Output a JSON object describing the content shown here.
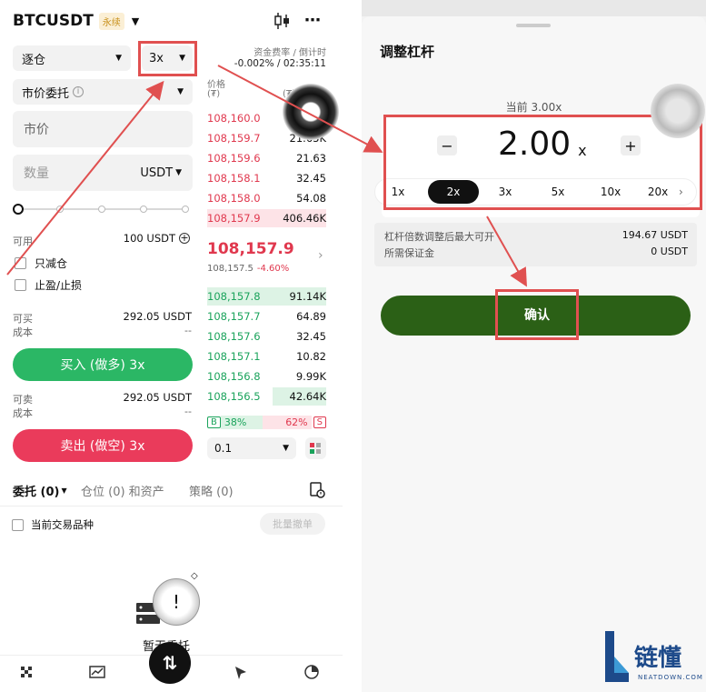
{
  "left": {
    "header": {
      "symbol": "BTCUSDT",
      "badge": "永续"
    },
    "margin_mode": "逐仓",
    "leverage": "3x",
    "funding": {
      "label": "资金费率 / 倒计时",
      "value": "-0.002% / 02:35:11"
    },
    "order_type": "市价委托",
    "price_col": {
      "label": "价格",
      "unit": "(₮)",
      "qty_label": "(₮)"
    },
    "price_input": "市价",
    "qty_input": "数量",
    "qty_unit": "USDT",
    "available_label": "可用",
    "available_value": "100 USDT",
    "reduce_only": "只减仓",
    "tp_sl": "止盈/止损",
    "buy_info": {
      "label1": "可买",
      "value1": "292.05 USDT",
      "label2": "成本",
      "value2": "--"
    },
    "buy_button": "买入 (做多) 3x",
    "sell_info": {
      "label1": "可卖",
      "value1": "292.05 USDT",
      "label2": "成本",
      "value2": "--"
    },
    "sell_button": "卖出 (做空) 3x",
    "asks": [
      {
        "price": "108,160.0",
        "qty": ""
      },
      {
        "price": "108,159.7",
        "qty": "21.63K"
      },
      {
        "price": "108,159.6",
        "qty": "21.63"
      },
      {
        "price": "108,158.1",
        "qty": "32.45"
      },
      {
        "price": "108,158.0",
        "qty": "54.08"
      },
      {
        "price": "108,157.9",
        "qty": "406.46K"
      }
    ],
    "last_price": "108,157.9",
    "mark_price": "108,157.5",
    "change": "-4.60%",
    "bids": [
      {
        "price": "108,157.8",
        "qty": "91.14K"
      },
      {
        "price": "108,157.7",
        "qty": "64.89"
      },
      {
        "price": "108,157.6",
        "qty": "32.45"
      },
      {
        "price": "108,157.1",
        "qty": "10.82"
      },
      {
        "price": "108,156.8",
        "qty": "9.99K"
      },
      {
        "price": "108,156.5",
        "qty": "42.64K"
      }
    ],
    "ratio": {
      "b": "B",
      "b_pct": "38%",
      "s_pct": "62%",
      "s": "S"
    },
    "depth_select": "0.1",
    "tabs": [
      "委托 (0)",
      "仓位 (0) 和资产",
      "策略 (0)"
    ],
    "current_symbol_only": "当前交易品种",
    "batch_cancel": "批量撤单",
    "empty_text": "暂无委托"
  },
  "right": {
    "title": "调整杠杆",
    "current": "当前 3.00x",
    "value": "2.00",
    "unit": "x",
    "minus": "−",
    "plus": "+",
    "chips": [
      "1x",
      "2x",
      "3x",
      "5x",
      "10x",
      "20x"
    ],
    "selected_chip": "2x",
    "info": [
      {
        "label": "杠杆倍数调整后最大可开",
        "value": "194.67 USDT"
      },
      {
        "label": "所需保证金",
        "value": "0 USDT"
      }
    ],
    "confirm": "确认",
    "brand_cn": "链懂",
    "brand_en": "NEATDOWN.COM"
  },
  "colors": {
    "buy": "#2bb765",
    "sell": "#ea3b5b",
    "confirm": "#2b6016",
    "highlight": "#e05050"
  }
}
